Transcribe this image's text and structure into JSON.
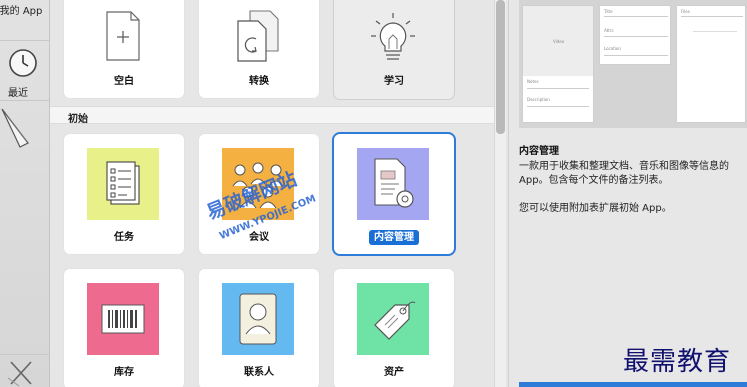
{
  "sidebar": {
    "items": [
      {
        "label": "我的 App",
        "icon": "my-apps-icon"
      },
      {
        "label": "最近",
        "icon": "clock-icon"
      },
      {
        "label": "",
        "icon": "close-x-icon"
      }
    ]
  },
  "templates_top": [
    {
      "label": "空白",
      "icon": "blank-document-icon"
    },
    {
      "label": "转换",
      "icon": "convert-document-icon"
    },
    {
      "label": "学习",
      "icon": "lightbulb-icon"
    }
  ],
  "section": {
    "title": "初始"
  },
  "starter_templates": [
    {
      "label": "任务",
      "icon": "task-checklist-icon",
      "bg": "#e8f08a"
    },
    {
      "label": "会议",
      "icon": "meeting-people-icon",
      "bg": "#f4b041"
    },
    {
      "label": "内容管理",
      "icon": "content-document-gear-icon",
      "bg": "#a5a6f2"
    },
    {
      "label": "库存",
      "icon": "barcode-icon",
      "bg": "#ee6a8f"
    },
    {
      "label": "联系人",
      "icon": "contact-card-icon",
      "bg": "#63b9f0"
    },
    {
      "label": "资产",
      "icon": "asset-tag-icon",
      "bg": "#6ee3a5"
    }
  ],
  "preview": {
    "tiny_labels": [
      "Video",
      "Title",
      "Attrs",
      "Location",
      "Notes",
      "Files",
      "Description"
    ]
  },
  "details": {
    "title": "内容管理",
    "description": "一款用于收集和整理文档、音乐和图像等信息的 App。包含每个文件的备注列表。",
    "extra": "您可以使用附加表扩展初始 App。"
  },
  "watermarks": {
    "site_cn": "易破解网站",
    "site_url": "WWW.YPOJIE.COM",
    "brand": "最需教育"
  },
  "colors": {
    "accent": "#1a6fd6",
    "selected_border": "#2e7cd8"
  }
}
